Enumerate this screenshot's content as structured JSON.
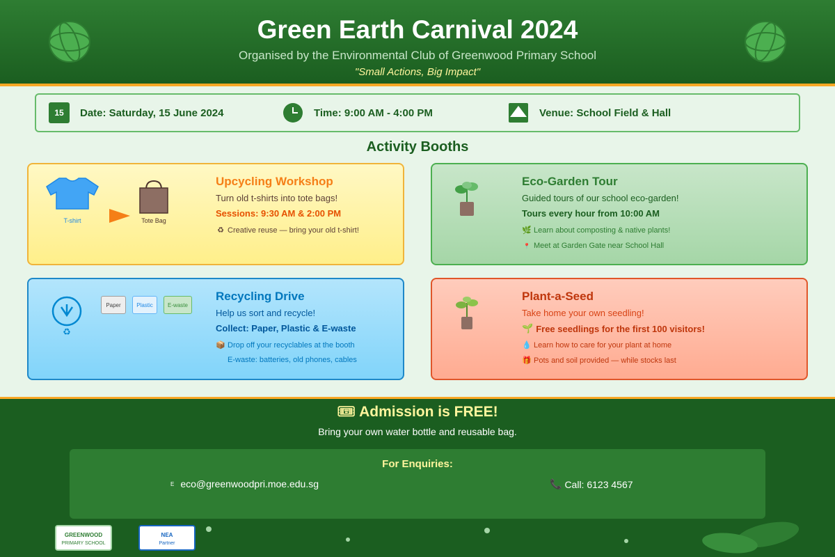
{
  "header": {
    "title": "Green Earth Carnival 2024",
    "subtitle": "Organised by the Environmental Club of Greenwood Primary School",
    "tagline": "\"Small Actions, Big Impact\""
  },
  "info": {
    "calendar_day": "15",
    "date": "Date: Saturday, 15 June 2024",
    "time": "Time: 9:00 AM - 4:00 PM",
    "venue": "Venue: School Field & Hall"
  },
  "section_title": "Activity Booths",
  "booths": [
    {
      "title": "Upcycling Workshop",
      "desc": "Turn old t-shirts into tote bags!",
      "bold": "Sessions: 9:30 AM & 2:00 PM",
      "notes": [
        {
          "icon": "recycle-icon",
          "text": "Creative reuse — bring your old t-shirt!"
        }
      ],
      "labels": [
        "T-shirt",
        "Tote Bag"
      ],
      "colors": {
        "title": "#f57f17",
        "bold": "#e65100"
      }
    },
    {
      "title": "Eco-Garden Tour",
      "desc": "Guided tours of our school eco-garden!",
      "bold": "Tours every hour from 10:00 AM",
      "notes": [
        {
          "icon": "leaf-icon",
          "text": "Learn about composting & native plants!"
        },
        {
          "icon": "pin-icon",
          "text": "Meet at Garden Gate near School Hall"
        }
      ],
      "colors": {
        "title": "#2e7d32",
        "bold": "#1b5e20"
      }
    },
    {
      "title": "Recycling Drive",
      "desc": "Help us sort and recycle!",
      "bold": "Collect: Paper, Plastic & E-waste",
      "notes": [
        {
          "icon": "box-icon",
          "text": "Drop off your recyclables at the booth"
        },
        {
          "icon": "",
          "text": "E-waste: batteries, old phones, cables"
        }
      ],
      "bins": [
        "Paper",
        "Plastic",
        "E-waste"
      ],
      "colors": {
        "title": "#0277bd",
        "bold": "#01579b"
      }
    },
    {
      "title": "Plant-a-Seed",
      "desc": "Take home your own seedling!",
      "bold": "Free seedlings for the first 100 visitors!",
      "notes": [
        {
          "icon": "drop-icon",
          "text": "Learn how to care for your plant at home"
        },
        {
          "icon": "gift-icon",
          "text": "Pots and soil provided — while stocks last"
        }
      ],
      "colors": {
        "title": "#bf360c",
        "bold": "#bf360c"
      }
    }
  ],
  "footer": {
    "admission": "Admission is FREE!",
    "bring": "Bring your own water bottle and reusable bag.",
    "enquiry_title": "For Enquiries:",
    "email_icon_letter": "E",
    "email": "eco@greenwoodpri.moe.edu.sg",
    "phone": "Call: 6123 4567",
    "logos": [
      {
        "name": "GREENWOOD",
        "sub": "PRIMARY SCHOOL"
      },
      {
        "name": "NEA",
        "sub": "Partner"
      }
    ]
  }
}
